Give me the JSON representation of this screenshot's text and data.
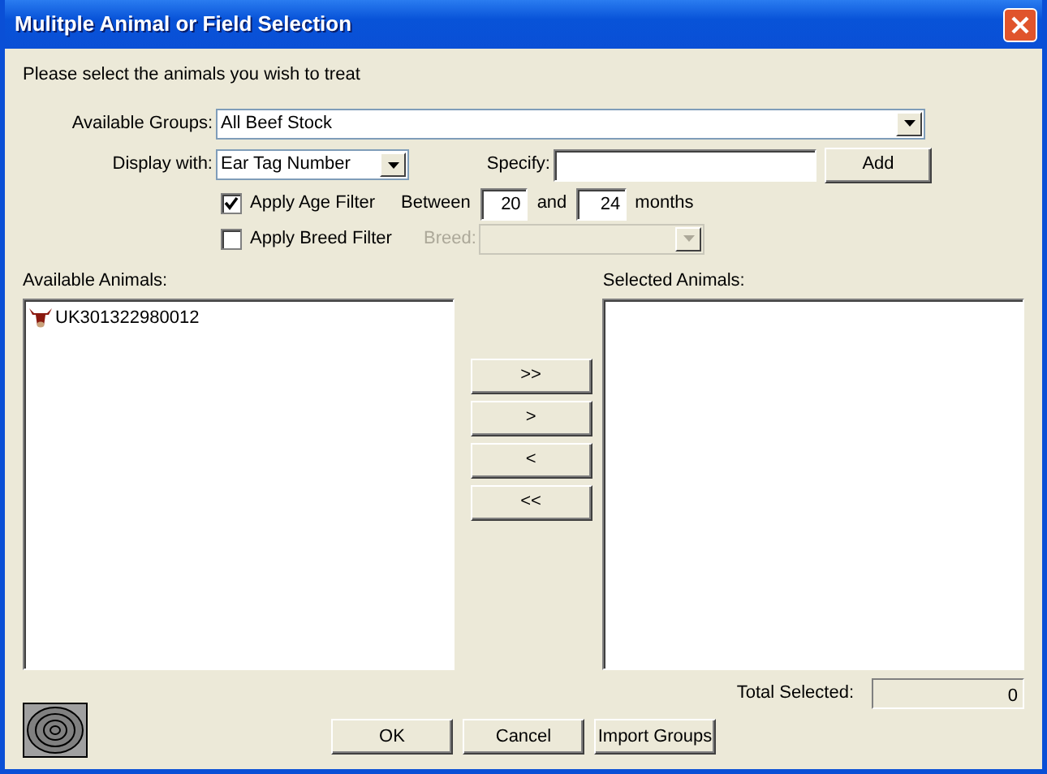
{
  "window": {
    "title": "Mulitple Animal or Field Selection"
  },
  "instruction": "Please select the animals you wish to treat",
  "available_groups": {
    "label": "Available Groups:",
    "value": "All Beef Stock"
  },
  "display_with": {
    "label": "Display with:",
    "value": "Ear Tag Number"
  },
  "specify": {
    "label": "Specify:"
  },
  "add_button": "Add",
  "age_filter": {
    "label": "Apply Age Filter",
    "checked": true,
    "between_label": "Between",
    "from": "20",
    "and_label": "and",
    "to": "24",
    "unit": "months"
  },
  "breed_filter": {
    "label": "Apply Breed Filter",
    "checked": false,
    "breed_label": "Breed:",
    "disabled": true
  },
  "available_animals": {
    "label": "Available Animals:",
    "items": [
      {
        "text": "UK301322980012",
        "selected": false
      }
    ]
  },
  "transfer_buttons": [
    ">>",
    ">",
    "<",
    "<<"
  ],
  "selected_animals": {
    "label": "Selected Animals:"
  },
  "total_selected": {
    "label": "Total Selected:",
    "value": "0"
  },
  "buttons": [
    "OK",
    "Cancel",
    "Import Groups"
  ]
}
